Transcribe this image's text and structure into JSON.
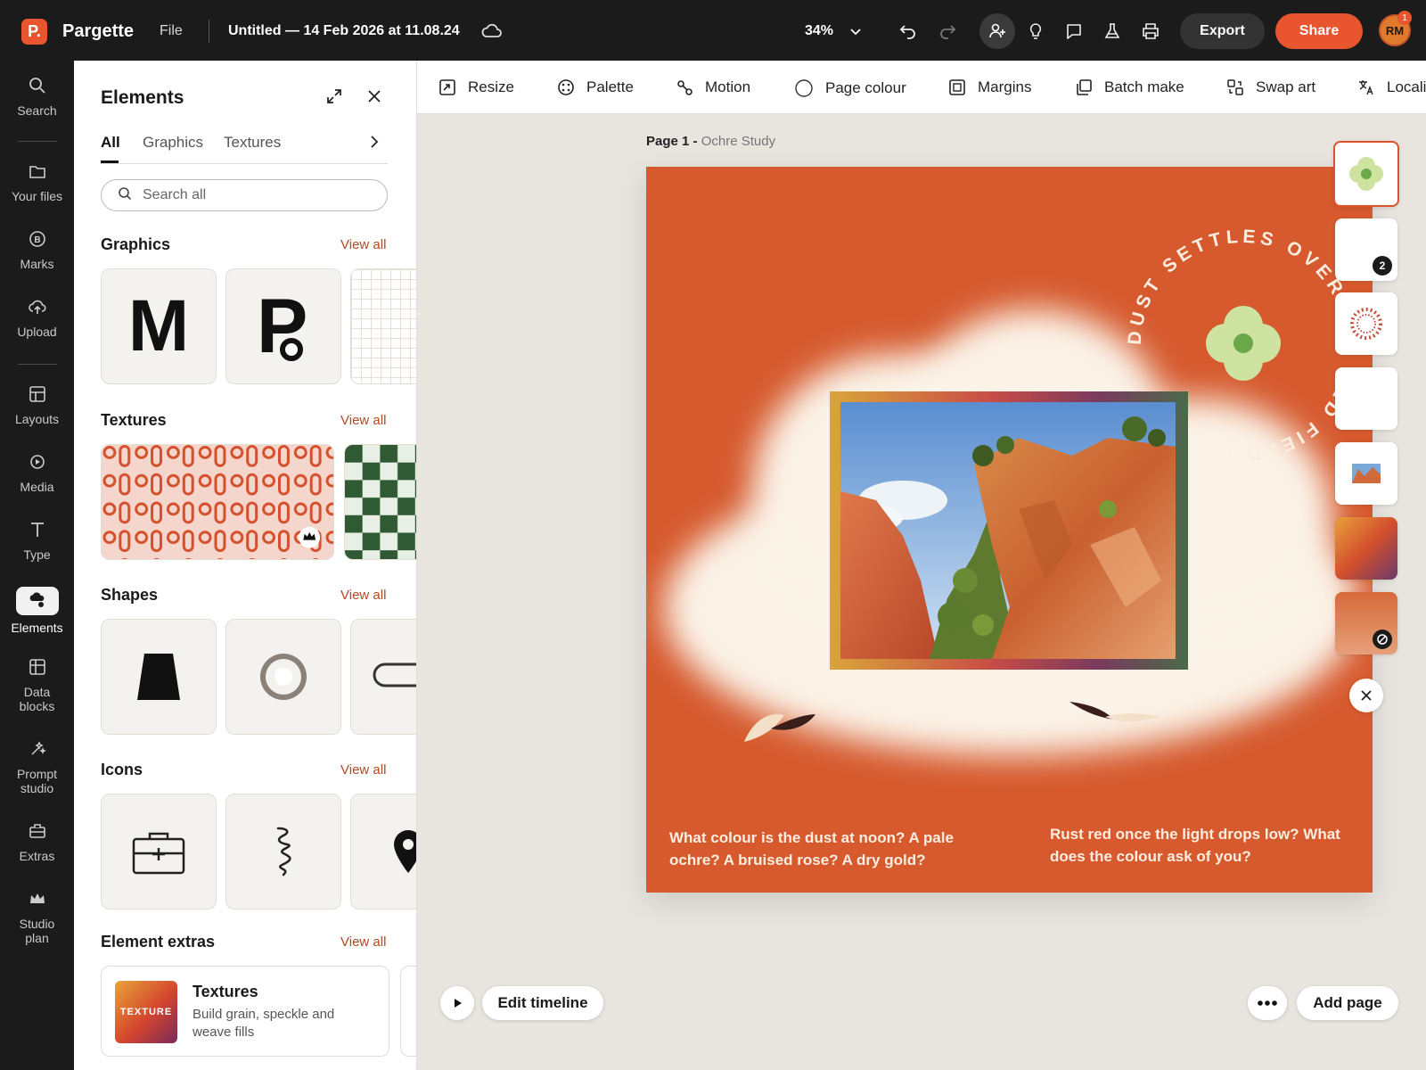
{
  "app": {
    "name": "Pargette",
    "logo_letter": "P.",
    "file_menu": "File",
    "document_title": "Untitled — 14 Feb 2026 at 11.08.24",
    "zoom": "34%"
  },
  "header": {
    "export_label": "Export",
    "share_label": "Share",
    "avatar_initials": "RM",
    "notification_count": "1",
    "accent": "#e8552e"
  },
  "rail": {
    "items": [
      {
        "label": "Search",
        "icon": "search-icon"
      },
      {
        "label": "Your files",
        "icon": "folder-icon"
      },
      {
        "label": "Marks",
        "icon": "brand-mark-icon"
      },
      {
        "label": "Upload",
        "icon": "upload-cloud-icon"
      },
      {
        "label": "Layouts",
        "icon": "layout-icon"
      },
      {
        "label": "Media",
        "icon": "media-icon"
      },
      {
        "label": "Type",
        "icon": "type-icon"
      },
      {
        "label": "Elements",
        "icon": "elements-icon",
        "active": true
      },
      {
        "label": "Data\nblocks",
        "icon": "data-blocks-icon"
      },
      {
        "label": "Prompt\nstudio",
        "icon": "sparkle-icon"
      },
      {
        "label": "Extras",
        "icon": "toolbox-icon"
      },
      {
        "label": "Studio\nplan",
        "icon": "crown-icon"
      }
    ]
  },
  "panel": {
    "title": "Elements",
    "tabs": [
      "All",
      "Graphics",
      "Textures"
    ],
    "search_placeholder": "Search all",
    "view_all": "View all",
    "sections": {
      "graphics": "Graphics",
      "textures": "Textures",
      "shapes": "Shapes",
      "icons": "Icons",
      "element_extras": "Element extras"
    },
    "graphics_tiles": [
      "M",
      "P"
    ],
    "extra_card": {
      "thumb_text": "TEXTURE",
      "title": "Textures",
      "description": "Build grain, speckle and weave fills"
    }
  },
  "toolbar": {
    "tools": [
      {
        "label": "Resize",
        "icon": "resize-icon"
      },
      {
        "label": "Palette",
        "icon": "palette-icon"
      },
      {
        "label": "Motion",
        "icon": "motion-icon"
      },
      {
        "label": "Page colour",
        "icon": "page-colour-icon"
      },
      {
        "label": "Margins",
        "icon": "margins-icon"
      },
      {
        "label": "Batch make",
        "icon": "batch-icon"
      },
      {
        "label": "Swap art",
        "icon": "swap-icon"
      },
      {
        "label": "Localis",
        "icon": "translate-icon"
      }
    ]
  },
  "canvas": {
    "page_label": "Page 1 -",
    "page_name": "Ochre Study",
    "circular_text": "DUST SETTLES OVER THE OLD FIELD ·",
    "question_left": "What colour is the dust at noon? A pale ochre? A bruised rose? A dry gold?",
    "question_right": "Rust red once the light drops low? What does the colour ask of you?",
    "background_color": "#d65a2e"
  },
  "thumbs": {
    "badge_count": "2"
  },
  "bottom": {
    "edit_timeline": "Edit timeline",
    "add_page": "Add page"
  }
}
